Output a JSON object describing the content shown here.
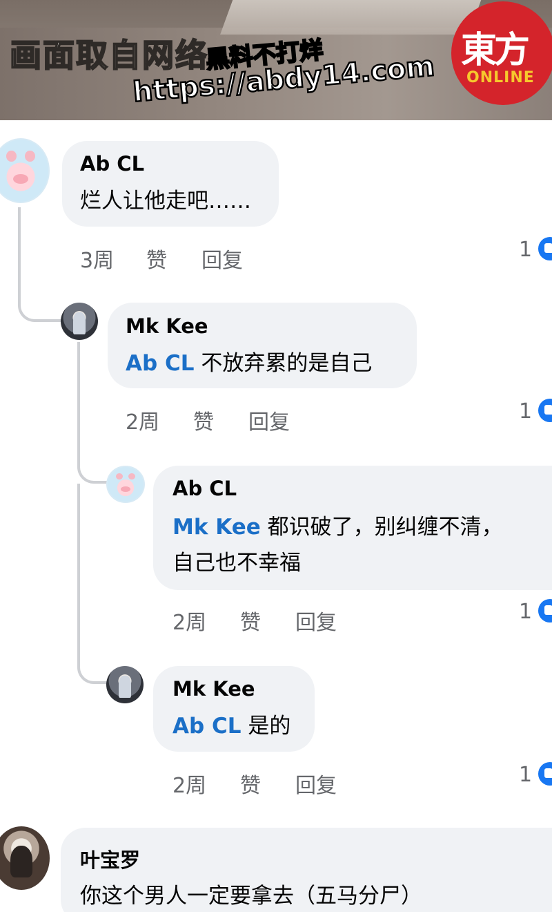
{
  "banner": {
    "caption": "画面取自网络",
    "watermark_line1": "黑料不打烊",
    "watermark_line2": "https://abdy14.com",
    "logo_chars": "東方",
    "logo_sub": "ONLINE"
  },
  "comments": [
    {
      "author": "Ab CL",
      "mention": "",
      "text": "烂人让他走吧……",
      "text2": "",
      "time": "3周",
      "like": "赞",
      "reply": "回复",
      "likes": "1"
    },
    {
      "author": "Mk Kee",
      "mention": "Ab CL",
      "text": " 不放弃累的是自己",
      "text2": "",
      "time": "2周",
      "like": "赞",
      "reply": "回复",
      "likes": "1"
    },
    {
      "author": "Ab CL",
      "mention": "Mk Kee",
      "text": " 都识破了，别纠缠不清，",
      "text2": "自己也不幸福",
      "time": "2周",
      "like": "赞",
      "reply": "回复",
      "likes": "1"
    },
    {
      "author": "Mk Kee",
      "mention": "Ab CL",
      "text": " 是的",
      "text2": "",
      "time": "2周",
      "like": "赞",
      "reply": "回复",
      "likes": "1"
    },
    {
      "author": "叶宝罗",
      "mention": "",
      "text": "你这个男人一定要拿去（五马分尸）",
      "text2": "",
      "time": "",
      "like": "",
      "reply": "",
      "likes": ""
    }
  ],
  "colors": {
    "mention": "#1b6fc7",
    "like_badge": "#1877f2",
    "bubble": "#f0f2f5"
  }
}
